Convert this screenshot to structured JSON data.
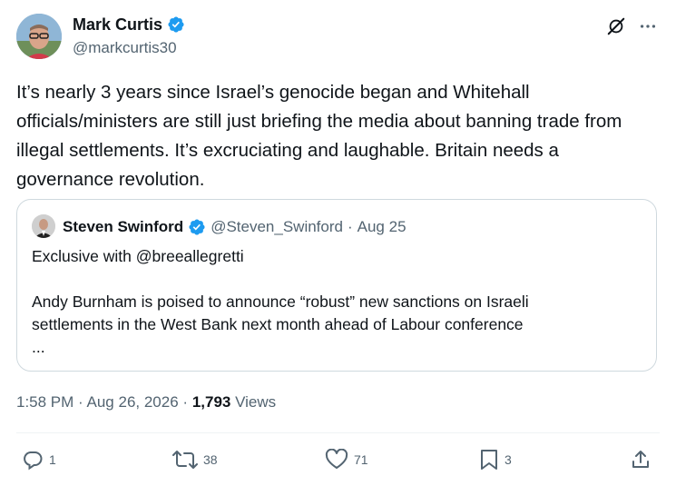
{
  "author": {
    "name": "Mark Curtis",
    "handle": "@markcurtis30"
  },
  "tweet": {
    "text": "It’s nearly 3 years since Israel’s genocide began and Whitehall officials/ministers are still just briefing the media about banning trade from illegal settlements. It’s excruciating and laughable. Britain needs a governance revolution."
  },
  "quoted": {
    "name": "Steven Swinford",
    "handle": "@Steven_Swinford",
    "separator": "·",
    "date": "Aug 25",
    "line1": "Exclusive with @breeallegretti",
    "line2": "Andy Burnham is poised to announce “robust” new sanctions on Israeli",
    "line3": "settlements in the West Bank next month ahead of Labour conference",
    "line4": "..."
  },
  "meta": {
    "time": "1:58 PM",
    "sep1": "·",
    "date": "Aug 26, 2026",
    "sep2": "·",
    "views_count": "1,793",
    "views_label": "Views"
  },
  "actions": {
    "replies": "1",
    "retweets": "38",
    "likes": "71",
    "bookmarks": "3"
  },
  "colors": {
    "verified": "#1d9bf0",
    "secondary_text": "#536471",
    "border": "#cfd9de"
  },
  "icons": [
    "verified-badge-icon",
    "grok-icon",
    "more-icon",
    "reply-icon",
    "retweet-icon",
    "like-icon",
    "bookmark-icon",
    "share-icon"
  ]
}
